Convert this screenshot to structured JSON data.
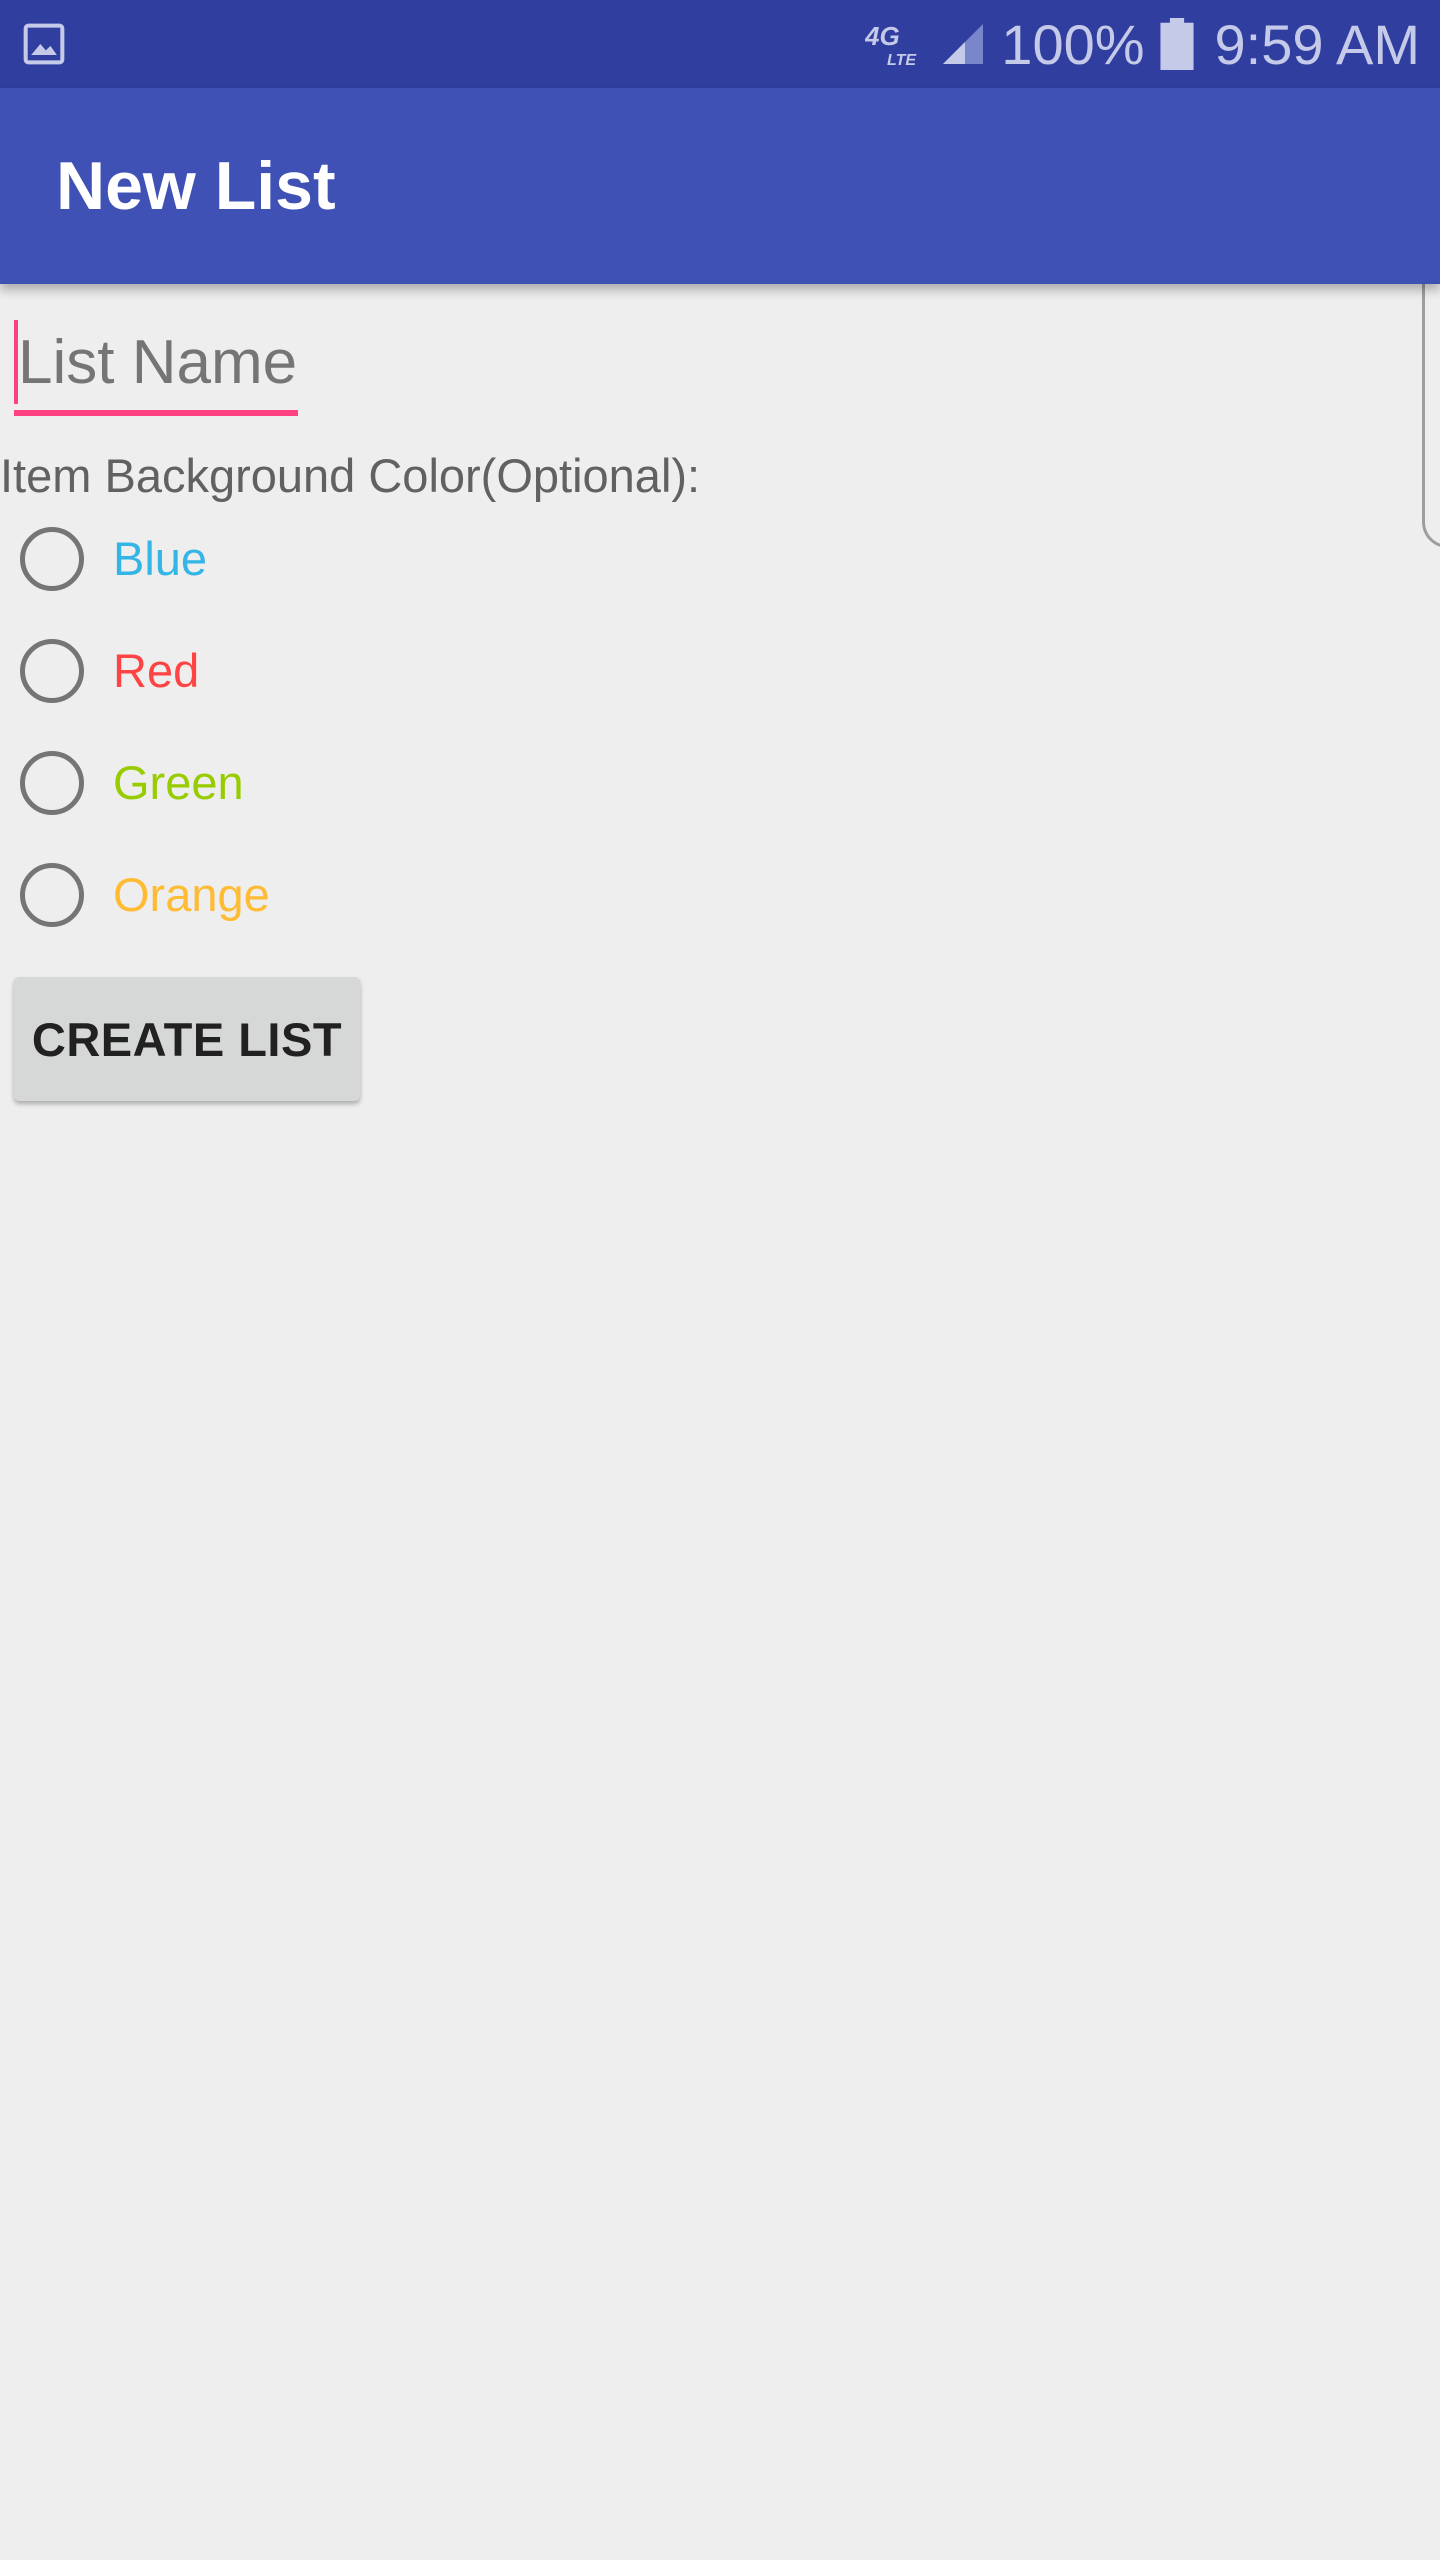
{
  "status_bar": {
    "notification_icon": "image-gallery-icon",
    "network_icon": "4g-lte-icon",
    "signal_icon": "cell-signal-icon",
    "battery_percent": "100%",
    "battery_icon": "battery-icon",
    "time": "9:59 AM"
  },
  "app_bar": {
    "title": "New List"
  },
  "form": {
    "list_name": {
      "placeholder": "List Name",
      "value": ""
    },
    "color_label": "Item Background Color(Optional):",
    "color_options": [
      {
        "label": "Blue",
        "color": "#33b5e5",
        "selected": false
      },
      {
        "label": "Red",
        "color": "#ff4444",
        "selected": false
      },
      {
        "label": "Green",
        "color": "#99cc00",
        "selected": false
      },
      {
        "label": "Orange",
        "color": "#ffbb33",
        "selected": false
      }
    ],
    "create_button_label": "CREATE LIST"
  },
  "colors": {
    "status_bar": "#303f9f",
    "app_bar": "#3f51b5",
    "accent": "#ff4081",
    "background": "#eeeeee",
    "button": "#d6d7d7"
  }
}
